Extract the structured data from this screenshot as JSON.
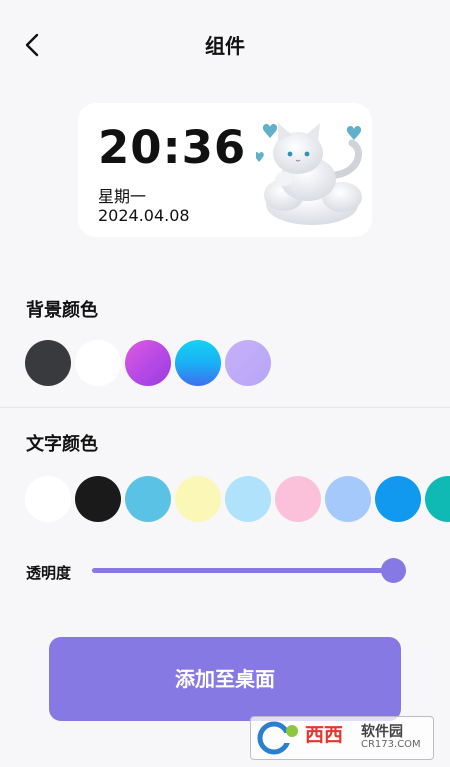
{
  "header": {
    "title": "组件",
    "back_icon": "chevron-left-icon"
  },
  "widget": {
    "time": "20:36",
    "weekday": "星期一",
    "date": "2024.04.08",
    "sticker": "cat-cloud-sticker"
  },
  "background_colors": {
    "title": "背景颜色",
    "colors": [
      "#383a3e",
      "#ffffff",
      "#b549e6",
      "#1ab0f4",
      "#b7a4f7"
    ]
  },
  "text_colors": {
    "title": "文字颜色",
    "colors": [
      "#ffffff",
      "#1a1a1a",
      "#5ac2e4",
      "#fbf7b6",
      "#b0e2fb",
      "#fcc1da",
      "#a4c9fa",
      "#1199ef",
      "#10bab4"
    ]
  },
  "opacity": {
    "label": "透明度",
    "value": 1.0
  },
  "add_button": {
    "label": "添加至桌面"
  },
  "watermark": {
    "main": "西西",
    "sub": "软件园",
    "url": "CR173.COM"
  },
  "colors": {
    "accent": "#8679e4",
    "background": "#f7f7f9"
  }
}
